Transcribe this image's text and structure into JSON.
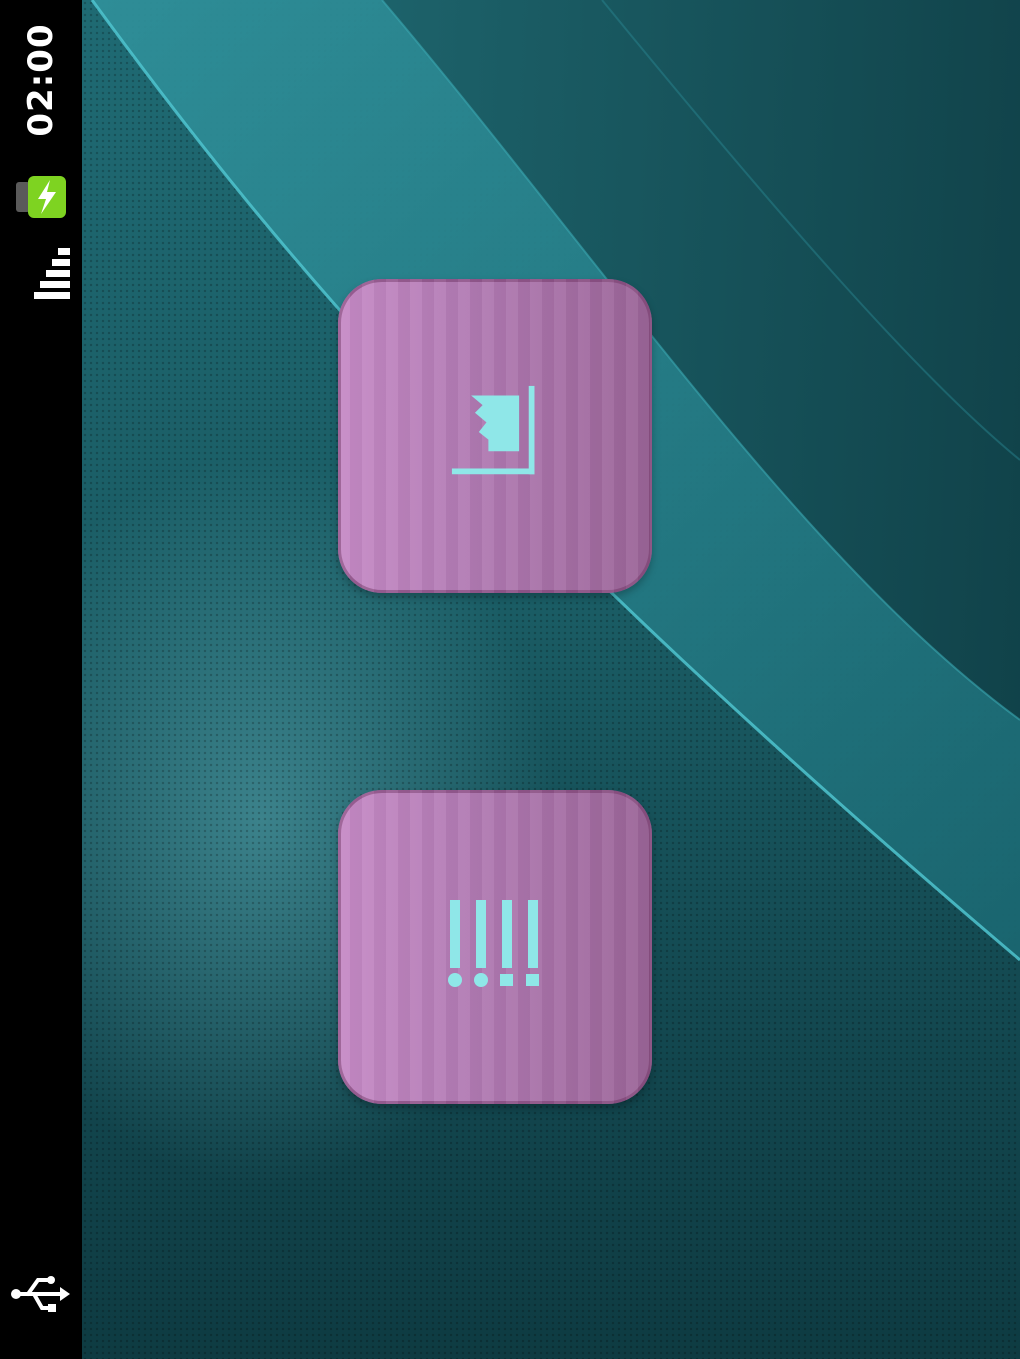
{
  "status_bar": {
    "time": "02:00",
    "icons": {
      "battery": "battery-charging-icon",
      "signal": "signal-strength-icon",
      "usb": "usb-icon"
    },
    "colors": {
      "background": "#000000",
      "battery_fill": "#7ed321",
      "text": "#ffffff"
    }
  },
  "home": {
    "tiles": [
      {
        "icon": "corner-crop-icon"
      },
      {
        "icon": "barcode-dots-icon"
      }
    ],
    "colors": {
      "tile": "#b27bb4",
      "tile_icon": "#8fe7e8",
      "wallpaper": "#1a5c64"
    }
  }
}
